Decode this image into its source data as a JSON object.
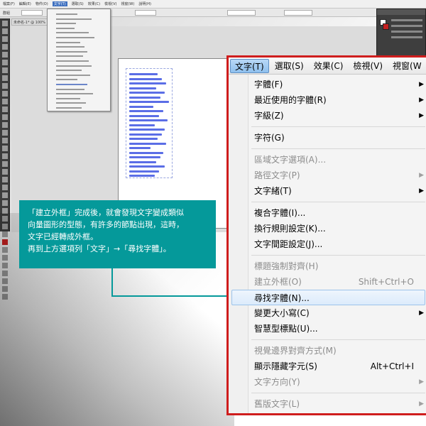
{
  "background_app": {
    "menubar_items": [
      "檔案(F)",
      "編輯(E)",
      "物件(O)",
      "文字(T)",
      "選取(S)",
      "效果(C)",
      "檢視(V)",
      "視窗(W)",
      "說明(H)"
    ],
    "active_menubar_index": 3,
    "control_label": "群組",
    "doc_tab_label": "未命名-1* @ 100%"
  },
  "callout": {
    "lines": [
      "「建立外框」完成後，就會發現文字變成類似",
      "向量圖形的型態，有許多的節點出現，這時，",
      "文字已經轉成外框。",
      "再到上方選項列「文字」→「尋找字體」。"
    ],
    "color": "#05999a"
  },
  "zoomed_menu": {
    "menubar": [
      {
        "label": "文字(T)",
        "active": true
      },
      {
        "label": "選取(S)",
        "active": false
      },
      {
        "label": "效果(C)",
        "active": false
      },
      {
        "label": "檢視(V)",
        "active": false
      },
      {
        "label": "視窗(W",
        "active": false
      }
    ],
    "items": [
      {
        "label": "字體(F)",
        "submenu": true,
        "disabled": false
      },
      {
        "label": "最近使用的字體(R)",
        "submenu": true,
        "disabled": false
      },
      {
        "label": "字級(Z)",
        "submenu": true,
        "disabled": false
      },
      {
        "separator": true
      },
      {
        "label": "字符(G)",
        "submenu": false,
        "disabled": false
      },
      {
        "separator": true
      },
      {
        "label": "區域文字選項(A)...",
        "submenu": false,
        "disabled": true
      },
      {
        "label": "路徑文字(P)",
        "submenu": true,
        "disabled": true
      },
      {
        "label": "文字緒(T)",
        "submenu": true,
        "disabled": false
      },
      {
        "separator": true
      },
      {
        "label": "複合字體(I)...",
        "submenu": false,
        "disabled": false
      },
      {
        "label": "換行規則設定(K)...",
        "submenu": false,
        "disabled": false
      },
      {
        "label": "文字間距設定(J)...",
        "submenu": false,
        "disabled": false
      },
      {
        "separator": true
      },
      {
        "label": "標題強制對齊(H)",
        "submenu": false,
        "disabled": true
      },
      {
        "label": "建立外框(O)",
        "shortcut": "Shift+Ctrl+O",
        "submenu": false,
        "disabled": true
      },
      {
        "label": "尋找字體(N)...",
        "submenu": false,
        "disabled": false,
        "highlight": true
      },
      {
        "label": "變更大小寫(C)",
        "submenu": true,
        "disabled": false
      },
      {
        "label": "智慧型標點(U)...",
        "submenu": false,
        "disabled": false
      },
      {
        "separator": true
      },
      {
        "label": "視覺邊界對齊方式(M)",
        "submenu": false,
        "disabled": true
      },
      {
        "label": "顯示隱藏字元(S)",
        "shortcut": "Alt+Ctrl+I",
        "submenu": false,
        "disabled": false
      },
      {
        "label": "文字方向(Y)",
        "submenu": true,
        "disabled": true
      },
      {
        "separator": true
      },
      {
        "label": "舊版文字(L)",
        "submenu": true,
        "disabled": true
      }
    ],
    "border_color": "#cf1d1d",
    "highlight_color": "#dcebfb"
  }
}
